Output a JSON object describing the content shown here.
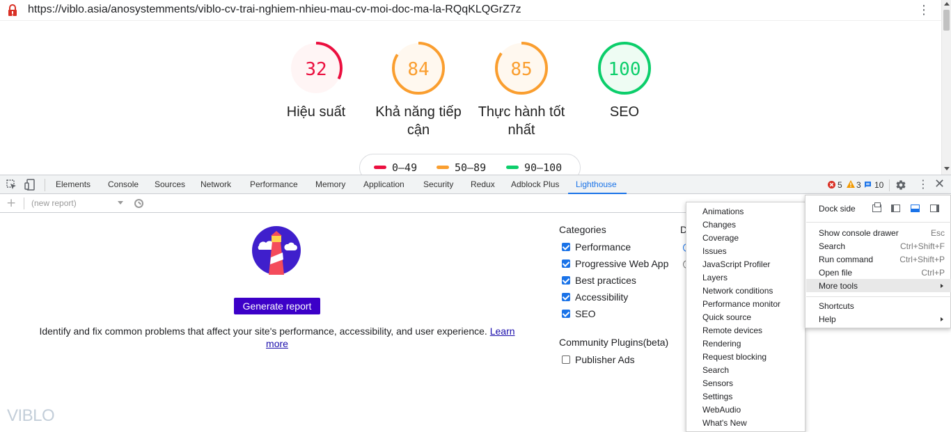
{
  "browser": {
    "url": "https://viblo.asia/anosystemments/viblo-cv-trai-nghiem-nhieu-mau-cv-moi-doc-ma-la-RQqKLQGrZ7z",
    "lock_icon": "insecure-lock-icon",
    "menu_icon": "kebab-icon"
  },
  "scores": [
    {
      "value": "32",
      "label": "Hiệu suất",
      "color": "#eb0f3f",
      "fill": 0.32
    },
    {
      "value": "84",
      "label": "Khả năng tiếp cận",
      "color": "#fa9e2f",
      "fill": 0.84
    },
    {
      "value": "85",
      "label": "Thực hành tốt nhất",
      "color": "#fa9e2f",
      "fill": 0.85
    },
    {
      "value": "100",
      "label": "SEO",
      "color": "#0cce6b",
      "fill": 1.0
    }
  ],
  "legend": [
    {
      "range": "0–49",
      "color": "#eb0f3f"
    },
    {
      "range": "50–89",
      "color": "#fa9e2f"
    },
    {
      "range": "90–100",
      "color": "#0cce6b"
    }
  ],
  "devtools": {
    "tabs": [
      "Elements",
      "Console",
      "Sources",
      "Network",
      "Performance",
      "Memory",
      "Application",
      "Security",
      "Redux",
      "Adblock Plus",
      "Lighthouse"
    ],
    "active_tab": "Lighthouse",
    "errors": "5",
    "warnings": "3",
    "messages": "10"
  },
  "lighthouse": {
    "report_select": "(new report)",
    "generate_button": "Generate report",
    "description": "Identify and fix common problems that affect your site's performance, accessibility, and user experience.",
    "learn_more": "Learn more",
    "categories_title": "Categories",
    "categories": [
      {
        "label": "Performance",
        "checked": true
      },
      {
        "label": "Progressive Web App",
        "checked": true
      },
      {
        "label": "Best practices",
        "checked": true
      },
      {
        "label": "Accessibility",
        "checked": true
      },
      {
        "label": "SEO",
        "checked": true
      }
    ],
    "plugins_title": "Community Plugins(beta)",
    "plugins": [
      {
        "label": "Publisher Ads",
        "checked": false
      }
    ],
    "device_partial": "D"
  },
  "more_tools_menu": [
    "Animations",
    "Changes",
    "Coverage",
    "Issues",
    "JavaScript Profiler",
    "Layers",
    "Network conditions",
    "Performance monitor",
    "Quick source",
    "Remote devices",
    "Rendering",
    "Request blocking",
    "Search",
    "Sensors",
    "Settings",
    "WebAudio",
    "What's New"
  ],
  "main_menu": {
    "dock_side": "Dock side",
    "items": [
      {
        "label": "Show console drawer",
        "shortcut": "Esc"
      },
      {
        "label": "Search",
        "shortcut": "Ctrl+Shift+F"
      },
      {
        "label": "Run command",
        "shortcut": "Ctrl+Shift+P"
      },
      {
        "label": "Open file",
        "shortcut": "Ctrl+P"
      },
      {
        "label": "More tools",
        "shortcut": ""
      }
    ],
    "items2": [
      {
        "label": "Shortcuts"
      },
      {
        "label": "Help"
      }
    ]
  },
  "watermark": "VIBLO"
}
